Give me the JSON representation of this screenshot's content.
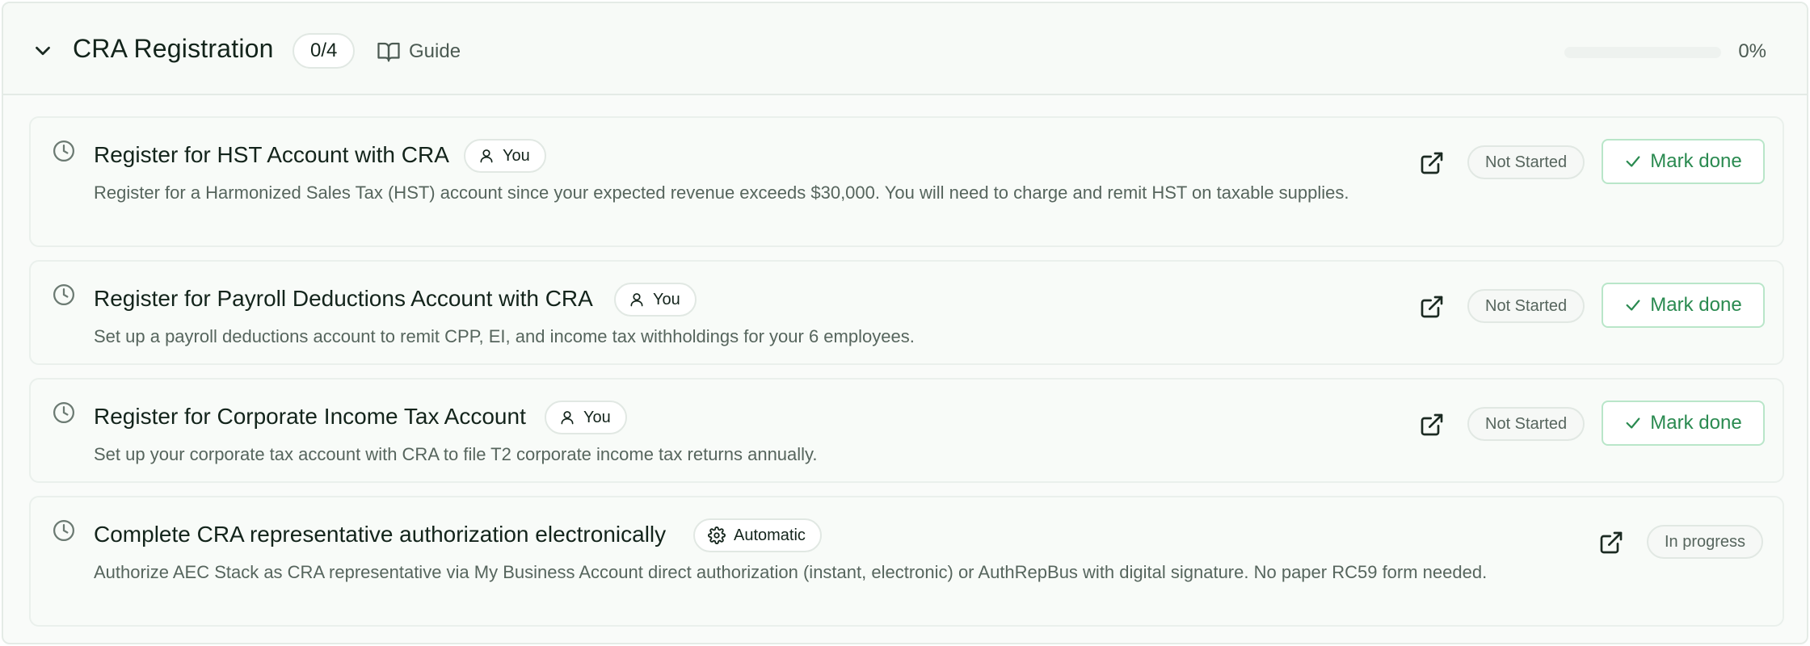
{
  "section": {
    "title": "CRA Registration",
    "count": "0/4",
    "guide_label": "Guide",
    "progress_percent": "0%",
    "progress_value": 0
  },
  "tasks": [
    {
      "title": "Register for HST Account with CRA",
      "owner": "You",
      "description": "Register for a Harmonized Sales Tax (HST) account since your expected revenue exceeds $30,000. You will need to charge and remit HST on taxable supplies.",
      "status": "Not Started",
      "action": "Mark done"
    },
    {
      "title": "Register for Payroll Deductions Account with CRA",
      "owner": "You",
      "description": "Set up a payroll deductions account to remit CPP, EI, and income tax withholdings for your 6 employees.",
      "status": "Not Started",
      "action": "Mark done"
    },
    {
      "title": "Register for Corporate Income Tax Account",
      "owner": "You",
      "description": "Set up your corporate tax account with CRA to file T2 corporate income tax returns annually.",
      "status": "Not Started",
      "action": "Mark done"
    },
    {
      "title": "Complete CRA representative authorization electronically",
      "owner": "Automatic",
      "description": "Authorize AEC Stack as CRA representative via My Business Account direct authorization (instant, electronic) or AuthRepBus with digital signature. No paper RC59 form needed.",
      "status": "In progress"
    }
  ],
  "icons": {
    "collapse": "chevron-down-icon",
    "guide": "book-open-icon",
    "pending": "clock-icon",
    "owner_user": "user-icon",
    "owner_auto": "gear-icon",
    "open": "external-link-icon",
    "done": "check-icon"
  },
  "colors": {
    "accent_green": "#2a8a50",
    "border": "#e4ebe6",
    "background": "#f9fbf9"
  }
}
